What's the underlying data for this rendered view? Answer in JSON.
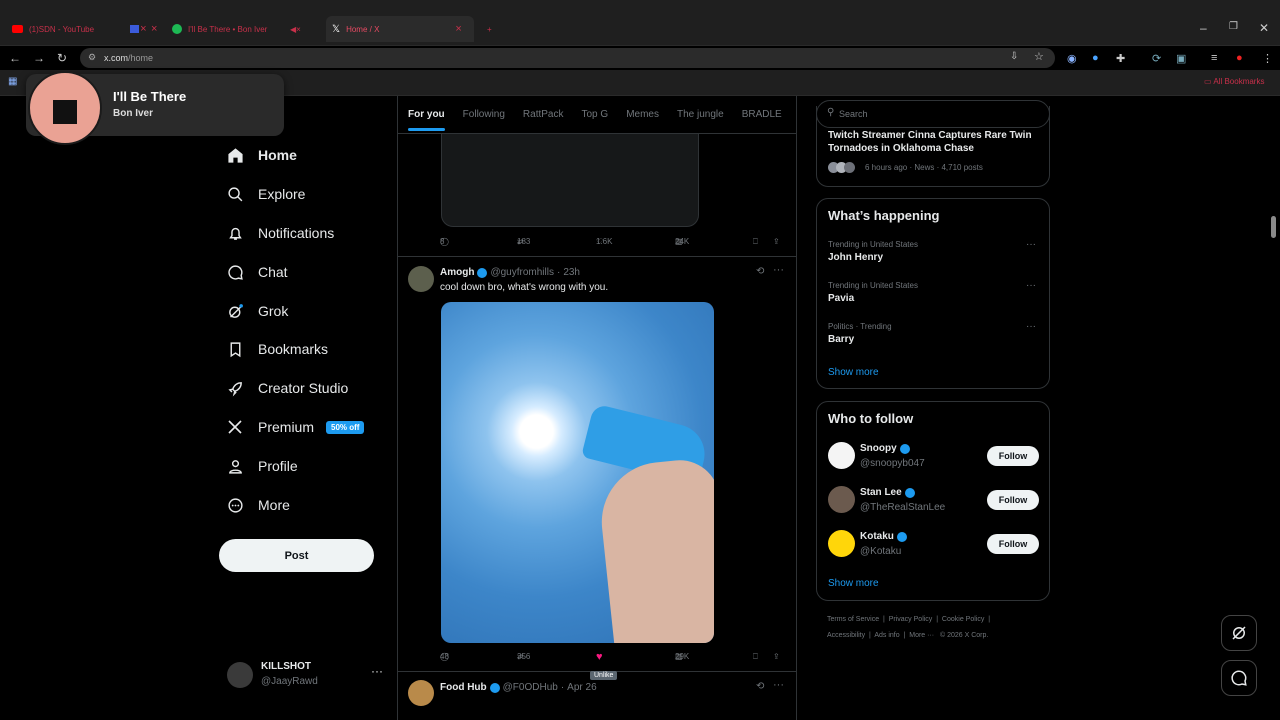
{
  "browser": {
    "tabs": [
      {
        "label": "(1)SDN - YouTube",
        "favicon_color": "#ff0000"
      },
      {
        "label": "",
        "favicon_color": "#3b5bdb"
      },
      {
        "label": "I'll Be There • Bon Iver",
        "favicon_color": "#1db954"
      },
      {
        "label": "",
        "favicon_color": "#c8304a"
      },
      {
        "label": "Home / X",
        "favicon_color": "#ffffff"
      }
    ],
    "address": {
      "host": "x.com",
      "path": "/home"
    },
    "bookmarks_label": "All Bookmarks"
  },
  "now_playing": {
    "title": "I'll Be There",
    "artist": "Bon Iver"
  },
  "nav": {
    "items": [
      {
        "label": "Home",
        "icon": "home-icon"
      },
      {
        "label": "Explore",
        "icon": "search-icon"
      },
      {
        "label": "Notifications",
        "icon": "bell-icon"
      },
      {
        "label": "Chat",
        "icon": "chat-icon"
      },
      {
        "label": "Grok",
        "icon": "grok-icon"
      },
      {
        "label": "Bookmarks",
        "icon": "bookmark-icon"
      },
      {
        "label": "Creator Studio",
        "icon": "rocket-icon"
      },
      {
        "label": "Premium",
        "icon": "x-logo-icon"
      },
      {
        "label": "Profile",
        "icon": "person-icon"
      },
      {
        "label": "More",
        "icon": "more-circle-icon"
      }
    ],
    "premium_badge": "50% off",
    "post_label": "Post"
  },
  "account": {
    "name": "KILLSHOT",
    "handle": "@JaayRawd"
  },
  "feed": {
    "tabs": [
      "For you",
      "Following",
      "RattPack",
      "Top G",
      "Memes",
      "The jungle",
      "BRADLE"
    ],
    "prev_tweet_stats": {
      "replies": "8",
      "reposts": "183",
      "likes": "1.6K",
      "views": "24K"
    },
    "tweet": {
      "name": "Amogh",
      "handle": "@guyfromhills",
      "time": "23h",
      "text": "cool down bro, what's wrong with you.",
      "stats": {
        "replies": "48",
        "reposts": "356",
        "likes": "",
        "views": "29K"
      },
      "like_tooltip": "Unlike"
    },
    "next_tweet": {
      "name": "Food Hub",
      "handle": "@F0ODHub",
      "time": "Apr 26"
    }
  },
  "sidebar": {
    "search_placeholder": "Search",
    "news": {
      "headline": "Twitch Streamer Cinna Captures Rare Twin Tornadoes in Oklahoma Chase",
      "meta": "6 hours ago · News · 4,710 posts"
    },
    "happening": {
      "title": "What’s happening",
      "items": [
        {
          "context": "Trending in United States",
          "topic": "John Henry"
        },
        {
          "context": "Trending in United States",
          "topic": "Pavia"
        },
        {
          "context": "Politics · Trending",
          "topic": "Barry"
        }
      ],
      "show_more": "Show more"
    },
    "who_to_follow": {
      "title": "Who to follow",
      "accounts": [
        {
          "name": "Snoopy",
          "handle": "@snoopyb047"
        },
        {
          "name": "Stan Lee",
          "handle": "@TheRealStanLee"
        },
        {
          "name": "Kotaku",
          "handle": "@Kotaku"
        }
      ],
      "follow_label": "Follow",
      "show_more": "Show more"
    },
    "footer": {
      "line1": [
        "Terms of Service",
        "Privacy Policy",
        "Cookie Policy"
      ],
      "line2": [
        "Accessibility",
        "Ads info",
        "More ···",
        "© 2026 X Corp."
      ]
    }
  },
  "colors": {
    "accent": "#1d9bf0",
    "like": "#f91880",
    "bg": "#000000"
  }
}
